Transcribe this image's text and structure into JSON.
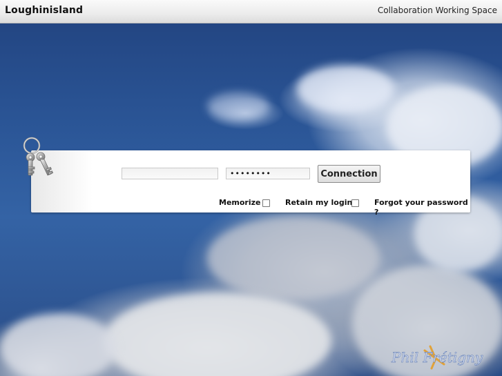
{
  "header": {
    "title": "Loughinisland",
    "subtitle": "Collaboration Working Space"
  },
  "login": {
    "username_value": "",
    "password_value": "••••••••",
    "connect_label": "Connection",
    "memorize_label": "Memorize",
    "retain_label": "Retain my login",
    "forgot_label": "Forgot your password ?",
    "memorize_checked": false,
    "retain_checked": false
  },
  "icons": {
    "keys": "keys-icon"
  },
  "signature": {
    "text": "Phil Frétigny"
  },
  "colors": {
    "sky": "#2f5da0",
    "header_bg": "#ececec",
    "panel_bg": "#ffffff"
  }
}
